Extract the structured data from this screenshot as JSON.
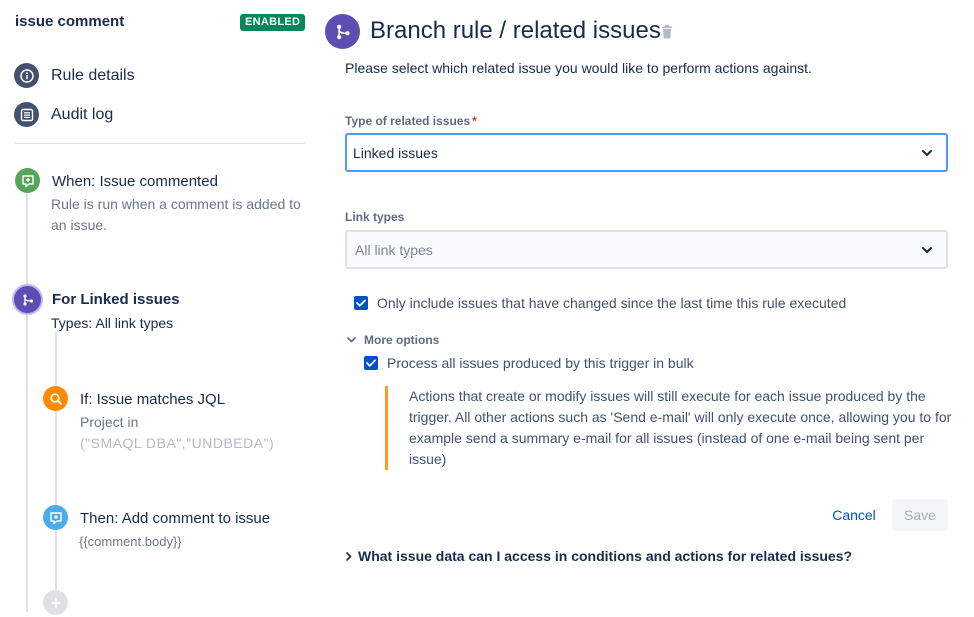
{
  "sidebar": {
    "rule_name": "issue comment",
    "status": "ENABLED",
    "nav": [
      {
        "label": "Rule details",
        "icon": "info-icon"
      },
      {
        "label": "Audit log",
        "icon": "list-icon"
      }
    ],
    "steps": {
      "trigger": {
        "title": "When: Issue commented",
        "desc": "Rule is run when a comment is added to an issue.",
        "icon": "comment-icon",
        "color": "#57a55a"
      },
      "branch": {
        "title": "For Linked issues",
        "desc": "Types: All link types",
        "icon": "branch-icon",
        "color": "#5e4db2"
      },
      "condition": {
        "title": "If: Issue matches JQL",
        "desc_line1": "Project in",
        "desc_line2": "(\"SMAQL DBA\",\"UNDBEDA\")",
        "icon": "search-icon",
        "color": "#ff8b00"
      },
      "action": {
        "title": "Then: Add comment to issue",
        "desc": "{{comment.body}}",
        "icon": "comment-icon",
        "color": "#4bade8"
      }
    }
  },
  "main": {
    "title": "Branch rule / related issues",
    "intro": "Please select which related issue you would like to perform actions against.",
    "type_field": {
      "label": "Type of related issues",
      "required": "*",
      "value": "Linked issues"
    },
    "link_field": {
      "label": "Link types",
      "placeholder": "All link types"
    },
    "only_changed": {
      "label": "Only include issues that have changed since the last time this rule executed",
      "checked": true
    },
    "more_options": {
      "label": "More options"
    },
    "bulk": {
      "label": "Process all issues produced by this trigger in bulk",
      "checked": true
    },
    "note": "Actions that create or modify issues will still execute for each issue produced by the trigger. All other actions such as 'Send e-mail' will only execute once, allowing you to for example send a summary e-mail for all issues (instead of one e-mail being sent per issue)",
    "cancel_label": "Cancel",
    "save_label": "Save",
    "faq": "What issue data can I access in conditions and actions for related issues?"
  },
  "colors": {
    "accent": "#0052cc",
    "enabled": "#00875a",
    "focus": "#4c9aff",
    "note_border": "#ff991f"
  }
}
